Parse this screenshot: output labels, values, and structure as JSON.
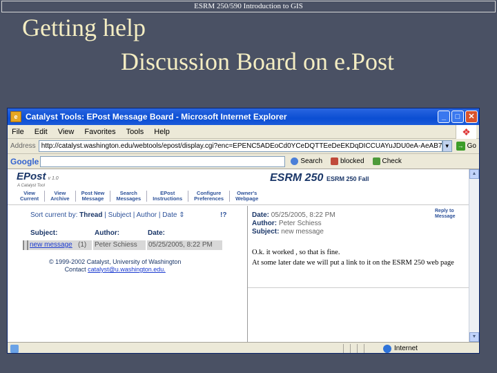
{
  "slide": {
    "header": "ESRM 250/590 Introduction to GIS",
    "title": "Getting help",
    "subtitle": "Discussion Board on e.Post"
  },
  "window": {
    "title": "Catalyst Tools: EPost Message Board - Microsoft Internet Explorer",
    "controls": {
      "minimize": "_",
      "maximize": "□",
      "close": "✕"
    }
  },
  "menubar": {
    "items": [
      "File",
      "Edit",
      "View",
      "Favorites",
      "Tools",
      "Help"
    ]
  },
  "addressbar": {
    "label": "Address",
    "url": "http://catalyst.washington.edu/webtools/epost/display.cgi?enc=EPENC5ADEoCd0YCeDQTTEeDeEKDqDICCUAYuJDU0eA-AeAB7oDXDUDxDLFeCwDgBr0M",
    "go_label": "Go"
  },
  "googlebar": {
    "logo": "Google",
    "search_label": "Search",
    "blocked_label": "blocked",
    "check_label": "Check"
  },
  "epost": {
    "logo": "EPost",
    "version": "v 1.0",
    "tagline": "A Catalyst Tool",
    "course_code": "ESRM 250",
    "course_term": "ESRM 250 Fall",
    "nav": [
      {
        "line1": "View",
        "line2": "Current"
      },
      {
        "line1": "View",
        "line2": "Archive"
      },
      {
        "line1": "Post New",
        "line2": "Message"
      },
      {
        "line1": "Search",
        "line2": "Messages"
      },
      {
        "line1": "EPost",
        "line2": "Instructions"
      },
      {
        "line1": "Configure",
        "line2": "Preferences"
      },
      {
        "line1": "Owner's",
        "line2": "Webpage"
      }
    ]
  },
  "list": {
    "sort_label": "Sort current by:",
    "sort_thread": "Thread",
    "sort_subject": "Subject",
    "sort_author": "Author",
    "sort_date": "Date",
    "sort_sep": "|",
    "sort_arrows": "⇕",
    "help": "!?",
    "headers": {
      "subject": "Subject:",
      "author": "Author:",
      "date": "Date:"
    },
    "rows": [
      {
        "subject": "new message",
        "count": "(1)",
        "author": "Peter Schiess",
        "date": "05/25/2005, 8:22 PM"
      }
    ],
    "copyright_line1": "© 1999-2002 Catalyst, University of Washington",
    "contact_label": "Contact",
    "contact_email": "catalyst@u.washington.edu."
  },
  "message": {
    "date_label": "Date:",
    "date_value": "05/25/2005, 8:22 PM",
    "author_label": "Author:",
    "author_value": "Peter Schiess",
    "subject_label": "Subject:",
    "subject_value": "new message",
    "reply_line1": "Reply to",
    "reply_line2": "Message",
    "body_line1": "O.k. it worked , so that is fine.",
    "body_line2": "At some later date we will put a link to it on the ESRM 250 web page"
  },
  "statusbar": {
    "zone": "Internet"
  }
}
